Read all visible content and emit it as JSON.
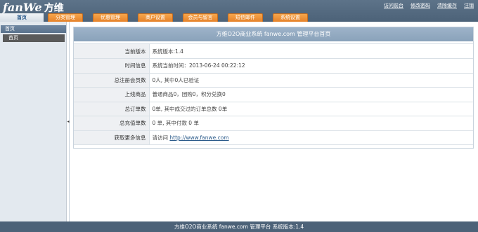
{
  "header": {
    "logo_latin": "fanWe",
    "logo_cn": "方维",
    "links": [
      "访问前台",
      "修改密码",
      "清除缓存",
      "注销"
    ],
    "tabs": [
      "分类管理",
      "优惠管理",
      "商户设置",
      "会员与留言",
      "短信邮件",
      "系统设置"
    ],
    "home_label": "首页"
  },
  "sidebar": {
    "section_title": "首页",
    "items": [
      "首页"
    ]
  },
  "main": {
    "title": "方维O2O商业系统 fanwe.com 管理平台首页",
    "rows": [
      {
        "label": "当前版本",
        "value": "系统版本:1.4"
      },
      {
        "label": "时间信息",
        "value": "系统当前时间：2013-06-24 00:22:12"
      },
      {
        "label": "总注册会员数",
        "value": "0人, 其中0人已验证"
      },
      {
        "label": "上线商品",
        "value": "普通商品0，团购0，积分兑换0"
      },
      {
        "label": "总订单数",
        "value": "0单, 其中成交过的订单总数 0单"
      },
      {
        "label": "总充值单数",
        "value": "0 单, 其中付款 0 单"
      },
      {
        "label": "获取更多信息",
        "value_prefix": "请访问 ",
        "link": "http://www.fanwe.com"
      }
    ]
  },
  "footer": {
    "text": "方维O2O商业系统 fanwe.com 管理平台 系统版本:1.4"
  }
}
